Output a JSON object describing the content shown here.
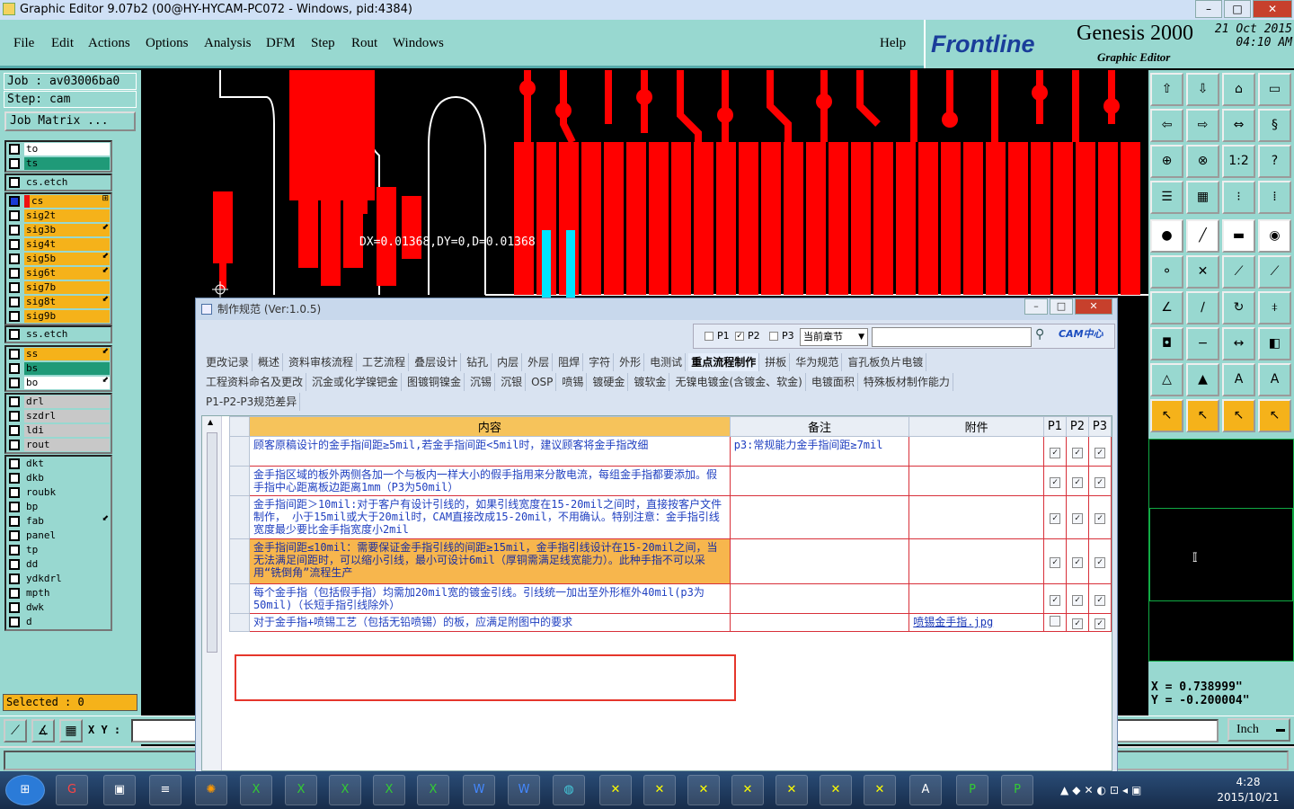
{
  "window": {
    "title": "Graphic Editor 9.07b2 (00@HY-HYCAM-PC072 - Windows, pid:4384)",
    "min_label": "–",
    "max_label": "□",
    "close_label": "✕"
  },
  "menu": {
    "items": [
      "File",
      "Edit",
      "Actions",
      "Options",
      "Analysis",
      "DFM",
      "Step",
      "Rout",
      "Windows"
    ],
    "help": "Help"
  },
  "brand": {
    "logo_text": "Frontline",
    "product": "Genesis 2000",
    "subtitle": "Graphic Editor",
    "date": "21 Oct 2015",
    "time": "04:10 AM"
  },
  "job": {
    "job_label": "Job : av03006ba0",
    "step_label": "Step: cam",
    "matrix_button": "Job Matrix ..."
  },
  "layers": {
    "group1": [
      {
        "name": "to",
        "color": "#ffffff"
      },
      {
        "name": "ts",
        "color": "#1f9a78"
      }
    ],
    "group2": [
      {
        "name": "cs.etch",
        "color": "#98d8d0"
      }
    ],
    "group3": [
      {
        "name": "cs",
        "color": "#f5b21a",
        "tag": "⊞",
        "work": true
      },
      {
        "name": "sig2t",
        "color": "#f5b21a"
      },
      {
        "name": "sig3b",
        "color": "#f5b21a",
        "tag": "⬋"
      },
      {
        "name": "sig4t",
        "color": "#f5b21a"
      },
      {
        "name": "sig5b",
        "color": "#f5b21a",
        "tag": "⬋"
      },
      {
        "name": "sig6t",
        "color": "#f5b21a",
        "tag": "⬋"
      },
      {
        "name": "sig7b",
        "color": "#f5b21a"
      },
      {
        "name": "sig8t",
        "color": "#f5b21a",
        "tag": "⬋"
      },
      {
        "name": "sig9b",
        "color": "#f5b21a"
      }
    ],
    "group4": [
      {
        "name": "ss.etch",
        "color": "#98d8d0"
      }
    ],
    "group5": [
      {
        "name": "ss",
        "color": "#f5b21a",
        "tag": "⬋"
      },
      {
        "name": "bs",
        "color": "#1f9a78"
      },
      {
        "name": "bo",
        "color": "#ffffff",
        "tag": "⬋"
      }
    ],
    "group6": [
      {
        "name": "drl",
        "color": "#c8c8c8"
      },
      {
        "name": "szdrl",
        "color": "#c8c8c8"
      },
      {
        "name": "ldi",
        "color": "#c8c8c8"
      },
      {
        "name": "rout",
        "color": "#c8c8c8"
      }
    ],
    "group7": [
      {
        "name": "dkt",
        "color": "#98d8d0"
      },
      {
        "name": "dkb",
        "color": "#98d8d0"
      },
      {
        "name": "roubk",
        "color": "#98d8d0"
      },
      {
        "name": "bp",
        "color": "#98d8d0"
      },
      {
        "name": "fab",
        "color": "#98d8d0",
        "tag": "⬋"
      },
      {
        "name": "panel",
        "color": "#98d8d0"
      },
      {
        "name": "tp",
        "color": "#98d8d0"
      },
      {
        "name": "dd",
        "color": "#98d8d0"
      },
      {
        "name": "ydkdrl",
        "color": "#98d8d0"
      },
      {
        "name": "mpth",
        "color": "#98d8d0"
      },
      {
        "name": "dwk",
        "color": "#98d8d0"
      },
      {
        "name": "d",
        "color": "#98d8d0"
      }
    ]
  },
  "selected": "Selected : 0",
  "xybar": {
    "label": "X Y :",
    "unit": "Inch"
  },
  "canvas": {
    "measurement": "DX=0.01368,DY=0,D=0.01368"
  },
  "coords": {
    "x": "X = 0.738999\"",
    "y": "Y = -0.200004\""
  },
  "dialog": {
    "title": "制作规范 (Ver:1.0.5)",
    "filters": [
      "P1",
      "P2",
      "P3"
    ],
    "chapter": "当前章节",
    "cam_logo": "CAM中心",
    "tabs_row1": [
      "更改记录",
      "概述",
      "资料审核流程",
      "工艺流程",
      "叠层设计",
      "钻孔",
      "内层",
      "外层",
      "阻焊",
      "字符",
      "外形",
      "电测试",
      "重点流程制作",
      "拼板",
      "华为规范",
      "盲孔板负片电镀"
    ],
    "active_tab": "重点流程制作",
    "tabs_row2": [
      "工程资料命名及更改",
      "沉金或化学镍钯金",
      "图镀铜镍金",
      "沉锡",
      "沉银",
      "OSP",
      "喷锡",
      "镀硬金",
      "镀软金",
      "无镍电镀金(含镀金、软金)",
      "电镀面积",
      "特殊板材制作能力"
    ],
    "tabs_row3": [
      "P1-P2-P3规范差异"
    ],
    "columns": [
      "内容",
      "备注",
      "附件",
      "P1",
      "P2",
      "P3"
    ],
    "rows": [
      {
        "content": "顾客原稿设计的金手指间距≥5mil,若金手指间距<5mil时，建议顾客将金手指改细",
        "note": "p3:常规能力金手指间距≥7mil",
        "attachment": "",
        "p1": true,
        "p2": true,
        "p3": true
      },
      {
        "content": "金手指区域的板外两侧各加一个与板内一样大小的假手指用来分散电流，每组金手指都要添加。假手指中心距离板边距离1mm（P3为50mil）",
        "note": "",
        "attachment": "",
        "p1": true,
        "p2": true,
        "p3": true
      },
      {
        "content": "金手指间距＞10mil:对于客户有设计引线的，如果引线宽度在15-20mil之间时，直接按客户文件制作， 小于15mil或大于20mil时，CAM直接改成15-20mil，不用确认。特别注意：金手指引线宽度最少要比金手指宽度小2mil",
        "note": "",
        "attachment": "",
        "p1": true,
        "p2": true,
        "p3": true
      },
      {
        "content": "金手指间距≤10mil：需要保证金手指引线的间距≥15mil，金手指引线设计在15-20mil之间，当无法满足间距时，可以缩小引线，最小可设计6mil（厚铜需满足线宽能力）。此种手指不可以采用“铣倒角”流程生产",
        "note": "",
        "attachment": "",
        "p1": true,
        "p2": true,
        "p3": true,
        "selected": true
      },
      {
        "content": "每个金手指（包括假手指）均需加20mil宽的镀金引线。引线统一加出至外形框外40mil(p3为50mil)（长短手指引线除外）",
        "note": "",
        "attachment": "",
        "p1": true,
        "p2": true,
        "p3": true
      },
      {
        "content": "对于金手指+喷锡工艺（包括无铅喷锡）的板，应满足附图中的要求",
        "note": "",
        "attachment": "喷锡金手指.jpg",
        "p1": false,
        "p2": true,
        "p3": true
      }
    ]
  },
  "taskbar": {
    "time": "4:28",
    "date": "2015/10/21"
  }
}
